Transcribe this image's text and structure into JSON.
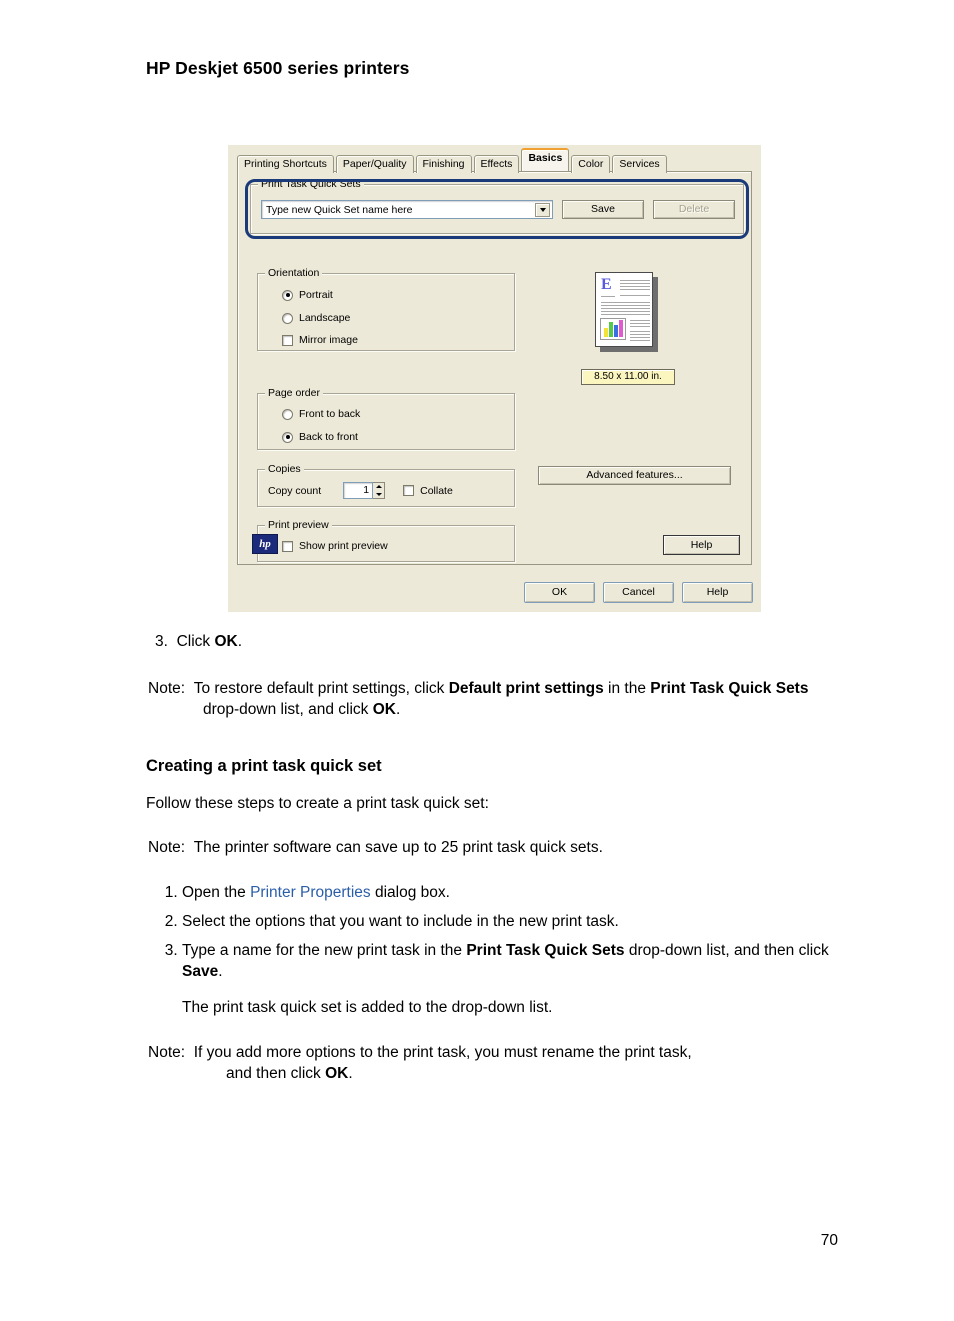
{
  "document": {
    "header": "HP Deskjet 6500 series printers",
    "page_number": "70",
    "section_heading": "Creating a print task quick set",
    "follow_line": "Follow these steps to create a print task quick set:",
    "step3_top_num": "3.",
    "step3_top_text": "Click ",
    "step3_top_bold": "OK",
    "step3_top_end": ".",
    "note_label": "Note:",
    "note1_a": "To restore default print settings, click ",
    "note1_b": "Default print settings",
    "note1_c": " in the ",
    "note1_d": "Print Task Quick Sets",
    "note1_e": " drop-down list, and click ",
    "note1_f": "OK",
    "note1_g": ".",
    "note2_text": "The printer software can save up to 25 print task quick sets.",
    "step1_a": "Open the ",
    "step1_link": "Printer Properties",
    "step1_b": " dialog box.",
    "step2_text": "Select the options that you want to include in the new print task.",
    "step3_a": "Type a name for the new print task in the ",
    "step3_bold": "Print Task Quick Sets",
    "step3_b": " drop-down list, and then click ",
    "step3_bold2": "Save",
    "step3_c": ".",
    "sub_note_text": "The print task quick set is added to the drop-down list.",
    "note3_a": "If you add more options to the print task, you must rename the print task,",
    "note3_b": "and then click ",
    "note3_bold": "OK",
    "note3_c": "."
  },
  "dialog": {
    "tabs": [
      {
        "label": "Printing Shortcuts",
        "active": false
      },
      {
        "label": "Paper/Quality",
        "active": false
      },
      {
        "label": "Finishing",
        "active": false
      },
      {
        "label": "Effects",
        "active": false
      },
      {
        "label": "Basics",
        "active": true
      },
      {
        "label": "Color",
        "active": false
      },
      {
        "label": "Services",
        "active": false
      }
    ],
    "quick_sets": {
      "legend": "Print Task Quick Sets",
      "combo_value": "Type new Quick Set name here",
      "save_label": "Save",
      "delete_label": "Delete",
      "delete_disabled": true
    },
    "orientation": {
      "legend": "Orientation",
      "portrait": "Portrait",
      "landscape": "Landscape",
      "mirror": "Mirror image",
      "selected": "Portrait",
      "mirror_checked": false
    },
    "page_order": {
      "legend": "Page order",
      "front_to_back": "Front to back",
      "back_to_front": "Back to front",
      "selected": "Back to front"
    },
    "copies": {
      "legend": "Copies",
      "copy_count_label": "Copy count",
      "copy_count_value": "1",
      "collate_label": "Collate",
      "collate_checked": false
    },
    "print_preview": {
      "legend": "Print preview",
      "show_label": "Show print preview",
      "checked": false
    },
    "preview": {
      "thumb_letter": "E",
      "paper_size": "8.50 x 11.00 in.",
      "chart_bar_colors": [
        "#f2e23a",
        "#57c94a",
        "#3a6fe0",
        "#e05ad0"
      ]
    },
    "advanced_button": "Advanced features...",
    "help_inner": "Help",
    "footer_buttons": [
      "OK",
      "Cancel",
      "Help"
    ],
    "logo_text": "hp",
    "colors": {
      "face": "#ece9d8",
      "active_tab_accent": "#f0a030",
      "highlight_ring": "#1b3a7a",
      "chip": "#fbf5c0",
      "link": "#2b5ea8"
    }
  }
}
